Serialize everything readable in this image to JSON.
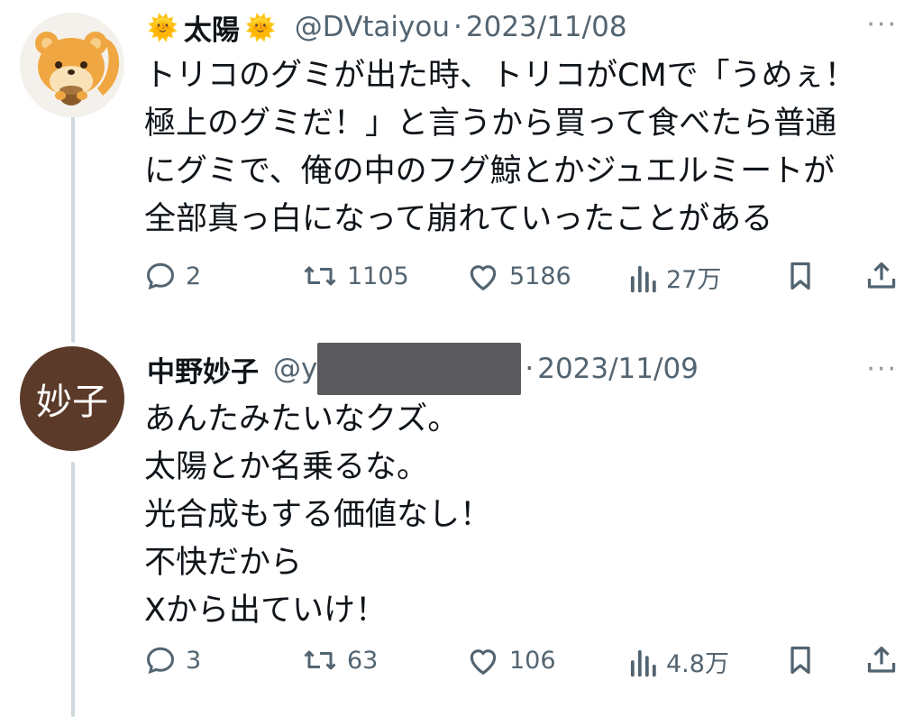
{
  "tweets": [
    {
      "display_name": "太陽",
      "name_emoji_left": "🌞",
      "name_emoji_right": "🌞",
      "handle": "@DVtaiyou",
      "dot": "·",
      "date": "2023/11/08",
      "more": "···",
      "text": "トリコのグミが出た時、トリコがCMで「うめぇ！\n極上のグミだ！」と言うから買って食べたら普通\nにグミで、俺の中のフグ鯨とかジュエルミートが\n全部真っ白になって崩れていったことがある",
      "replies": "2",
      "retweets": "1105",
      "likes": "5186",
      "views": "27万"
    },
    {
      "display_name": "中野妙子",
      "avatar_text": "妙子",
      "handle_prefix": "@y",
      "handle_suffix": "",
      "dot": "·",
      "date": "2023/11/09",
      "more": "···",
      "text": "あんたみたいなクズ。\n太陽とか名乗るな。\n光合成もする価値なし！\n不快だから\nXから出ていけ！",
      "replies": "3",
      "retweets": "63",
      "likes": "106",
      "views": "4.8万"
    }
  ],
  "colors": {
    "text": "#0f1419",
    "secondary": "#536471",
    "thread_line": "#cfd9de",
    "avatar2_bg": "#5b3a29"
  },
  "icons": [
    "reply-icon",
    "retweet-icon",
    "like-icon",
    "views-icon",
    "bookmark-icon",
    "share-icon",
    "more-icon"
  ]
}
